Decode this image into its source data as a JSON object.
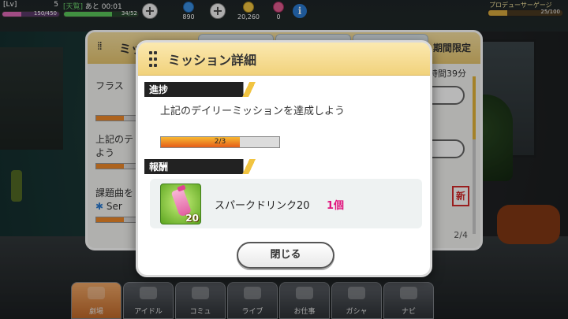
{
  "status_bar": {
    "level_label": "[Lv]",
    "level_value": "5",
    "level_exp": "150/450",
    "level_exp_ratio": 0.33,
    "stamina_label": "[天覧]",
    "stamina_prefix": "あと",
    "stamina_timer": "00:01",
    "stamina_value": "34/52",
    "stamina_ratio": 0.65,
    "currency_1": "890",
    "currency_2": "20,260",
    "currency_3": "0",
    "producer_label": "プロデューサーゲージ",
    "producer_value": "25/100",
    "producer_ratio": 0.25,
    "info_icon_glyph": "i",
    "plus_glyph": "+"
  },
  "mission_panel": {
    "title": "ミッション",
    "limited_tab": "期間限定",
    "remaining_time": "時間39分",
    "row1_text": "フラス",
    "row2_text_line1": "上記のテ",
    "row2_text_line2": "よう",
    "row3_text_line1": "課題曲を",
    "row3_text_line2": "Ser",
    "sticker_text": "新",
    "pager": "2/4"
  },
  "bottom_nav": {
    "items": [
      {
        "label": "劇場"
      },
      {
        "label": "アイドル"
      },
      {
        "label": "コミュ"
      },
      {
        "label": "ライブ"
      },
      {
        "label": "お仕事"
      },
      {
        "label": "ガシャ"
      },
      {
        "label": "ナビ"
      }
    ]
  },
  "modal": {
    "title": "ミッション詳細",
    "progress_section": "進捗",
    "progress_description": "上記のデイリーミッションを達成しよう",
    "progress_text": "2/3",
    "progress_ratio": 0.667,
    "reward_section": "報酬",
    "reward_name": "スパークドリンク20",
    "reward_count": "1個",
    "reward_badge": "20",
    "close_label": "閉じる"
  },
  "colors": {
    "accent_gold": "#f1d27c",
    "progress_orange": "#e55c18",
    "reward_count_pink": "#e0147d"
  }
}
